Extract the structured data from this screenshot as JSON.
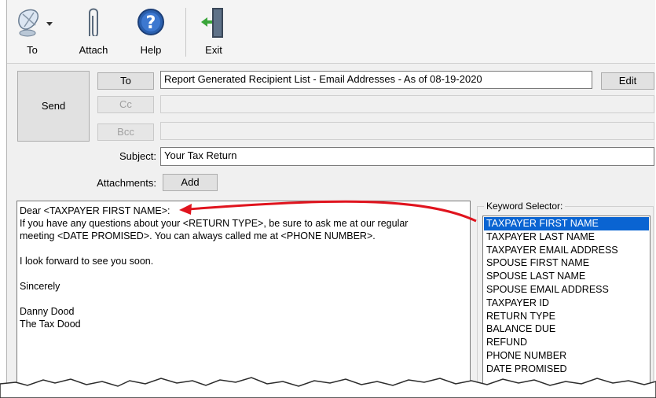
{
  "toolbar": {
    "to_label": "To",
    "attach_label": "Attach",
    "help_label": "Help",
    "exit_label": "Exit"
  },
  "send_label": "Send",
  "recipients": {
    "to_button": "To",
    "to_value": "Report Generated Recipient List - Email Addresses - As of 08-19-2020",
    "edit_button": "Edit",
    "cc_button": "Cc",
    "bcc_button": "Bcc"
  },
  "subject": {
    "label": "Subject:",
    "value": "Your Tax Return"
  },
  "attachments": {
    "label": "Attachments:",
    "add_button": "Add"
  },
  "body_lines": [
    "Dear <TAXPAYER FIRST NAME>:",
    "If you have any questions about your <RETURN TYPE>, be sure to ask me at our regular",
    "meeting <DATE PROMISED>. You can always called me at <PHONE NUMBER>.",
    "",
    "I look forward to see you soon.",
    "",
    "Sincerely",
    "",
    "Danny Dood",
    "The Tax Dood"
  ],
  "keyword_selector": {
    "title": "Keyword Selector:",
    "items": [
      "TAXPAYER FIRST NAME",
      "TAXPAYER LAST NAME",
      "TAXPAYER EMAIL ADDRESS",
      "SPOUSE FIRST NAME",
      "SPOUSE LAST NAME",
      "SPOUSE EMAIL ADDRESS",
      "TAXPAYER ID",
      "RETURN TYPE",
      "BALANCE DUE",
      "REFUND",
      "PHONE NUMBER",
      "DATE PROMISED"
    ],
    "selected": "TAXPAYER FIRST NAME"
  },
  "colors": {
    "selection": "#0a64d2",
    "arrow": "#e0141e"
  }
}
